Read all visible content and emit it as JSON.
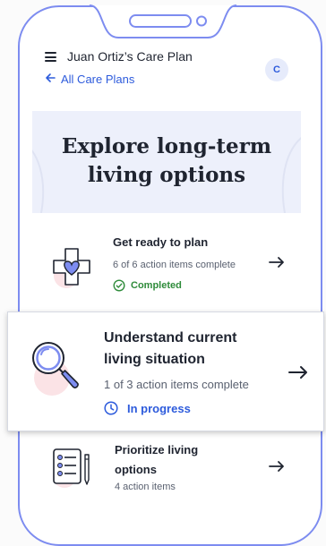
{
  "header": {
    "plan_title": "Juan Ortiz’s Care Plan",
    "back_label": "All Care Plans",
    "avatar_initial": "C"
  },
  "hero": {
    "title": "Explore long-term living options"
  },
  "steps": [
    {
      "title": "Get ready to plan",
      "count": "6 of 6 action items complete",
      "status": "Completed",
      "status_icon": "check-circle-icon",
      "icon": "medical-cross-heart-icon",
      "status_color": "#2e8b3a",
      "progress": 1
    },
    {
      "title": "Understand current living situation",
      "count": "1 of 3 action items complete",
      "status": "In progress",
      "status_icon": "clock-icon",
      "icon": "magnifying-glass-icon",
      "status_color": "#2d5bdc",
      "progress": 0.333
    },
    {
      "title": "Prioritize living options",
      "count": "4 action items",
      "icon": "checklist-clipboard-icon"
    }
  ],
  "colors": {
    "accent": "#2d5bdc",
    "frame": "#7d8cf0",
    "hero_bg": "#edf0fb",
    "success": "#2e8b3a"
  },
  "icons": {
    "menu": "hamburger-menu-icon",
    "back": "arrow-left-icon",
    "forward": "arrow-right-icon"
  }
}
